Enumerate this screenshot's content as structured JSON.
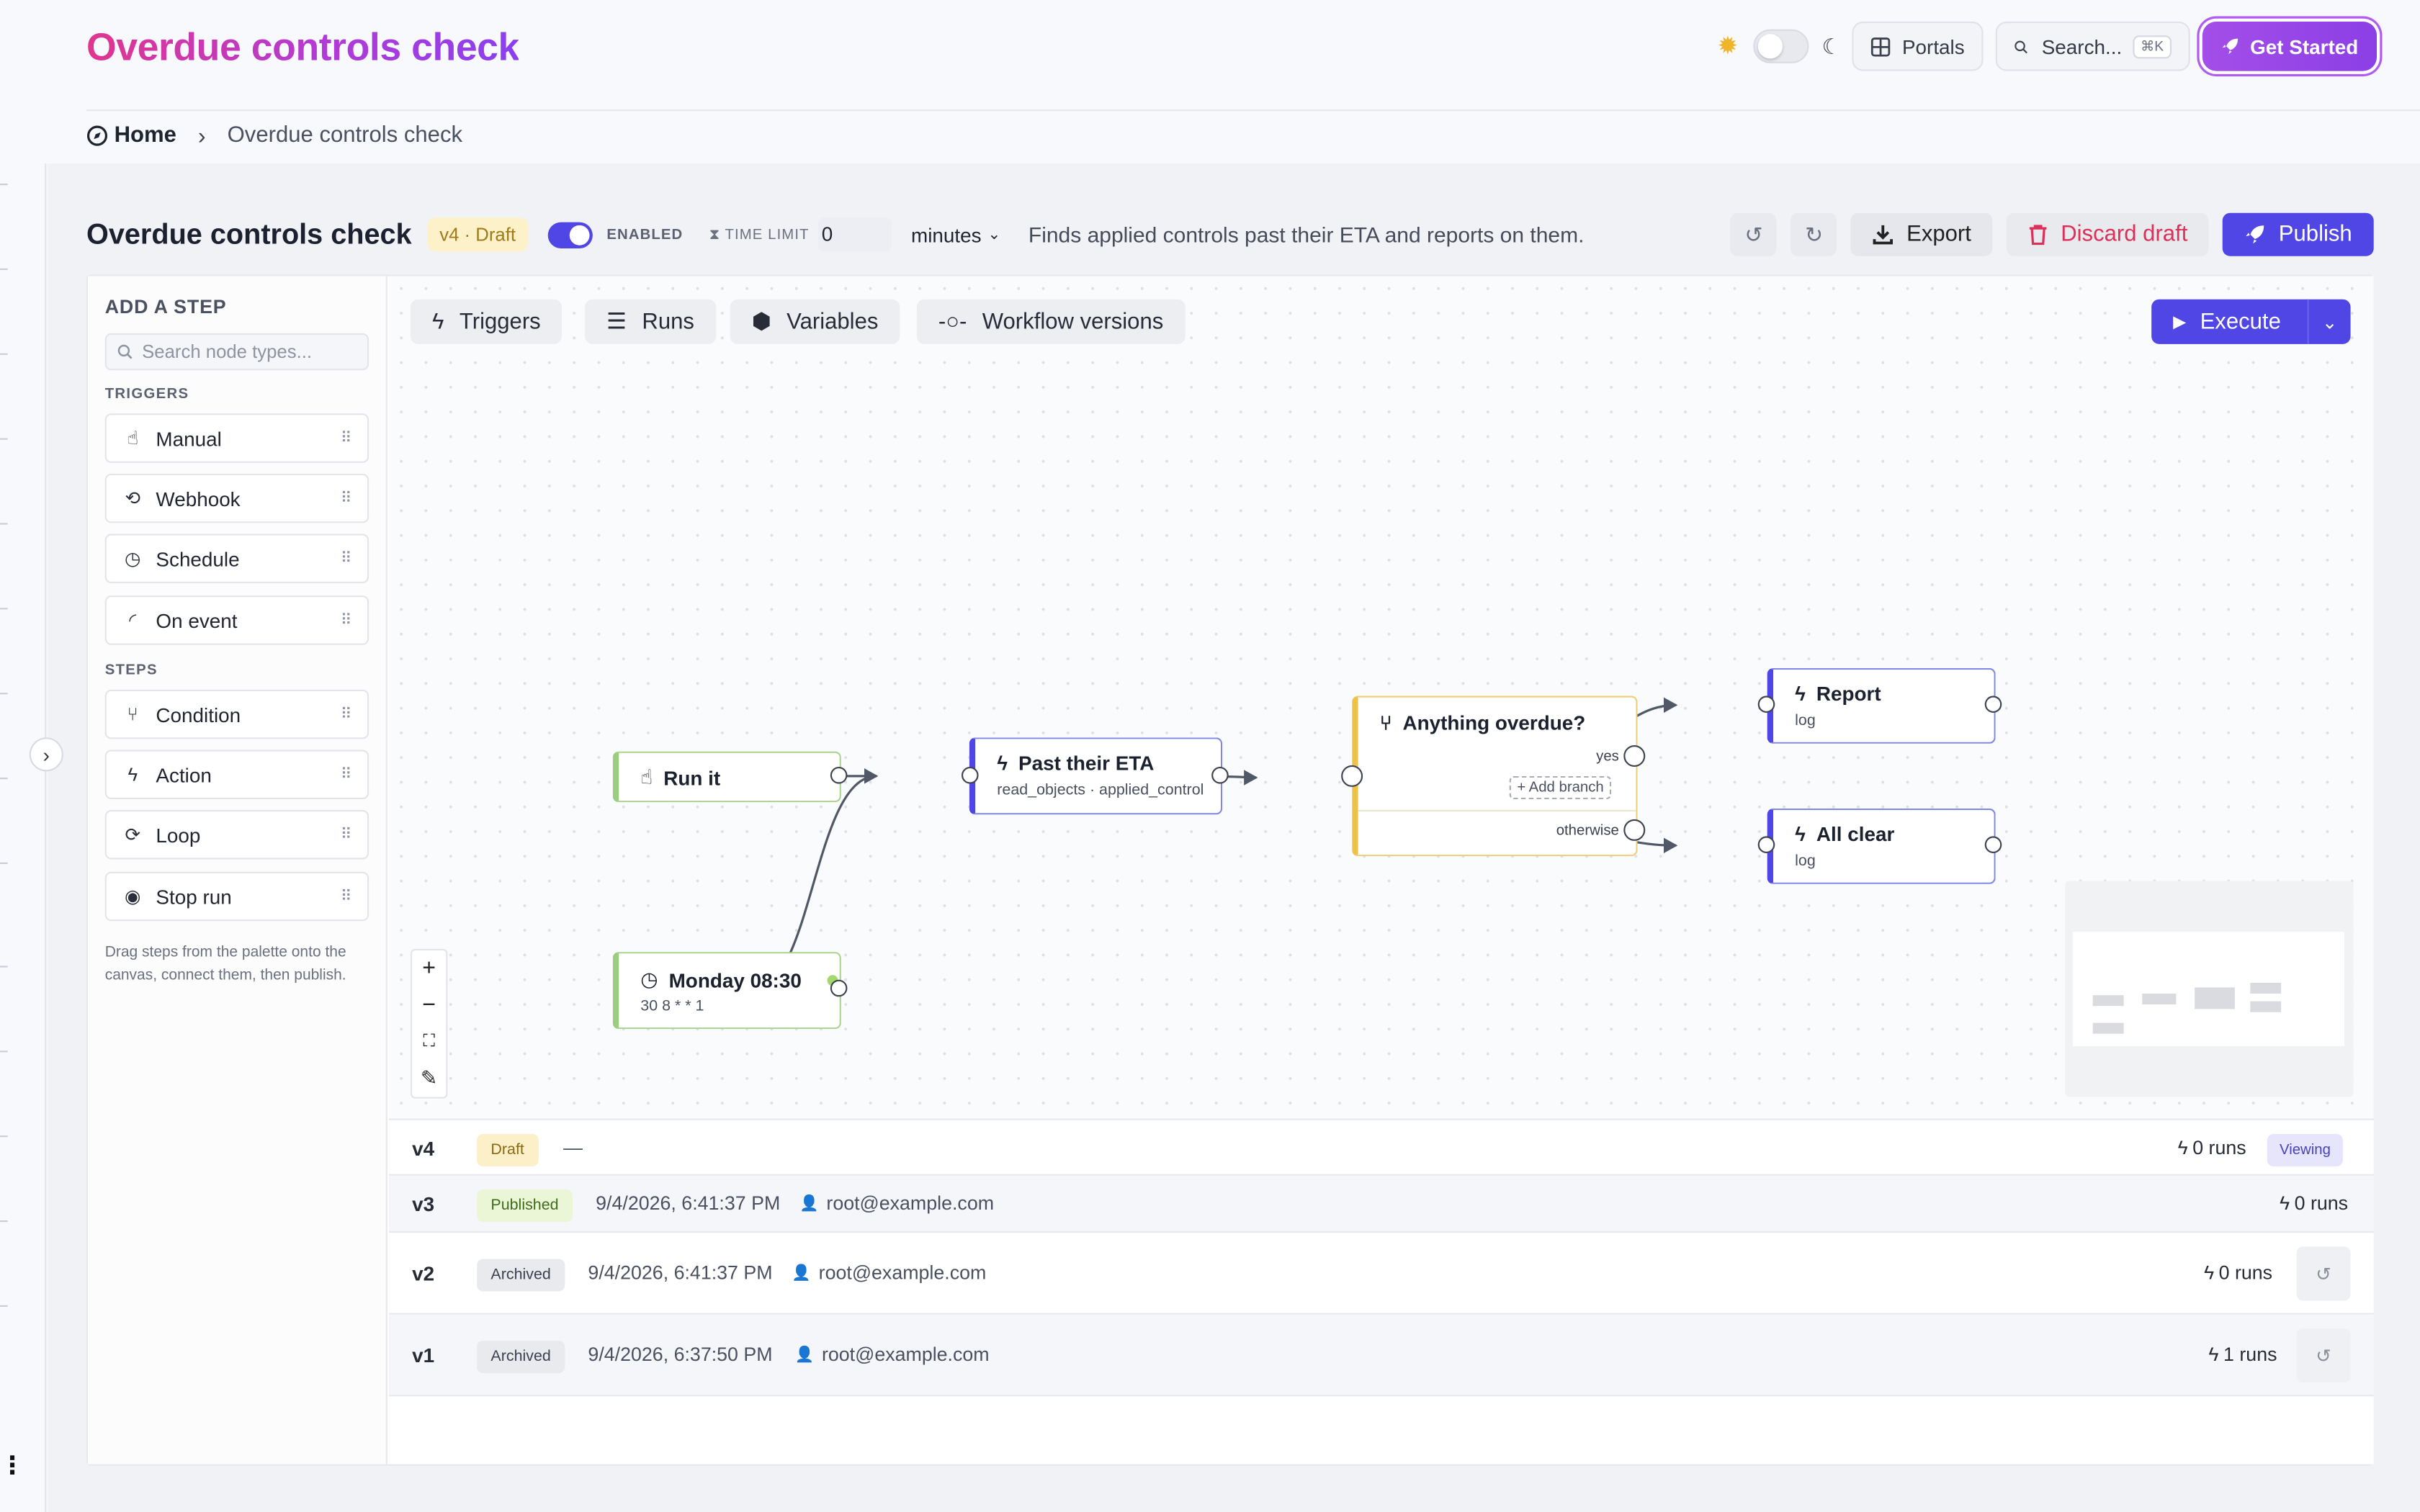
{
  "app": {
    "title": "Overdue controls check"
  },
  "header": {
    "portals_label": "Portals",
    "search_placeholder": "Search...",
    "search_shortcut": "⌘K",
    "get_started_label": "Get Started"
  },
  "breadcrumb": {
    "home": "Home",
    "current": "Overdue controls check"
  },
  "workflow": {
    "title": "Overdue controls check",
    "version_badge": "v4 · Draft",
    "enabled_label": "ENABLED",
    "time_limit_label": "TIME LIMIT",
    "time_limit_value": "0",
    "time_unit": "minutes",
    "description": "Finds applied controls past their ETA and reports on them.",
    "export_label": "Export",
    "discard_label": "Discard draft",
    "publish_label": "Publish"
  },
  "palette": {
    "title": "ADD A STEP",
    "search_placeholder": "Search node types...",
    "triggers_heading": "TRIGGERS",
    "triggers": [
      {
        "label": "Manual",
        "icon": "hand-pointer-icon"
      },
      {
        "label": "Webhook",
        "icon": "webhook-icon"
      },
      {
        "label": "Schedule",
        "icon": "clock-icon"
      },
      {
        "label": "On event",
        "icon": "rss-icon"
      }
    ],
    "steps_heading": "STEPS",
    "steps": [
      {
        "label": "Condition",
        "icon": "branch-icon"
      },
      {
        "label": "Action",
        "icon": "bolt-icon"
      },
      {
        "label": "Loop",
        "icon": "loop-icon"
      },
      {
        "label": "Stop run",
        "icon": "stop-icon"
      }
    ],
    "help": "Drag steps from the palette onto the canvas, connect them, then publish."
  },
  "canvas_tabs": {
    "triggers": "Triggers",
    "runs": "Runs",
    "variables": "Variables",
    "versions": "Workflow versions",
    "execute": "Execute"
  },
  "nodes": {
    "run_it": {
      "title": "Run it"
    },
    "monday": {
      "title": "Monday 08:30",
      "sub": "30 8 * * 1"
    },
    "past_eta": {
      "title": "Past their ETA",
      "sub": "read_objects · applied_control"
    },
    "anything_overdue": {
      "title": "Anything overdue?",
      "yes": "yes",
      "otherwise": "otherwise",
      "add_branch": "Add branch"
    },
    "report": {
      "title": "Report",
      "sub": "log"
    },
    "all_clear": {
      "title": "All clear",
      "sub": "log"
    }
  },
  "versions": [
    {
      "num": "v4",
      "status": "Draft",
      "date": "—",
      "user": "",
      "runs": "0 runs",
      "viewing": "Viewing"
    },
    {
      "num": "v3",
      "status": "Published",
      "date": "9/4/2026, 6:41:37 PM",
      "user": "root@example.com",
      "runs": "0 runs"
    },
    {
      "num": "v2",
      "status": "Archived",
      "date": "9/4/2026, 6:41:37 PM",
      "user": "root@example.com",
      "runs": "0 runs"
    },
    {
      "num": "v1",
      "status": "Archived",
      "date": "9/4/2026, 6:37:50 PM",
      "user": "root@example.com",
      "runs": "1 runs"
    }
  ],
  "colors": {
    "accent": "#4f46e5",
    "brand_gradient_start": "#e0368f",
    "brand_gradient_end": "#8b3ff0",
    "danger": "#dc2f5a"
  }
}
